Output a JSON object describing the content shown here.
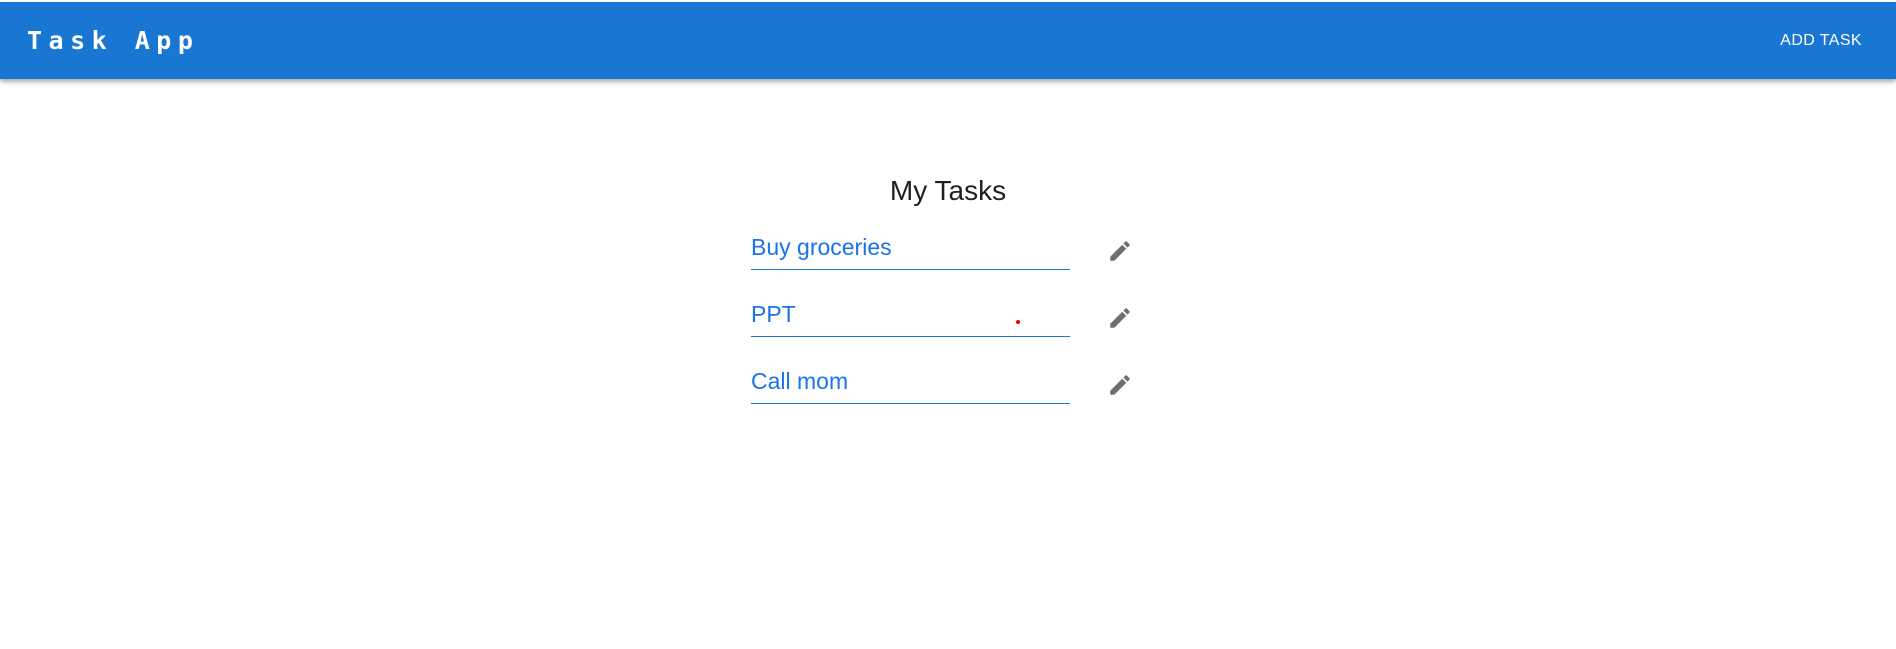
{
  "header": {
    "title": "Task App",
    "add_task_label": "ADD TASK"
  },
  "main": {
    "title": "My Tasks",
    "tasks": [
      {
        "value": "Buy groceries",
        "edit_icon": "pencil-icon"
      },
      {
        "value": "PPT",
        "edit_icon": "pencil-icon"
      },
      {
        "value": "Call mom",
        "edit_icon": "pencil-icon"
      }
    ]
  },
  "colors": {
    "app_bar": "#1976d2",
    "task_text": "#1a73e8",
    "icon": "#6f6f6f"
  }
}
